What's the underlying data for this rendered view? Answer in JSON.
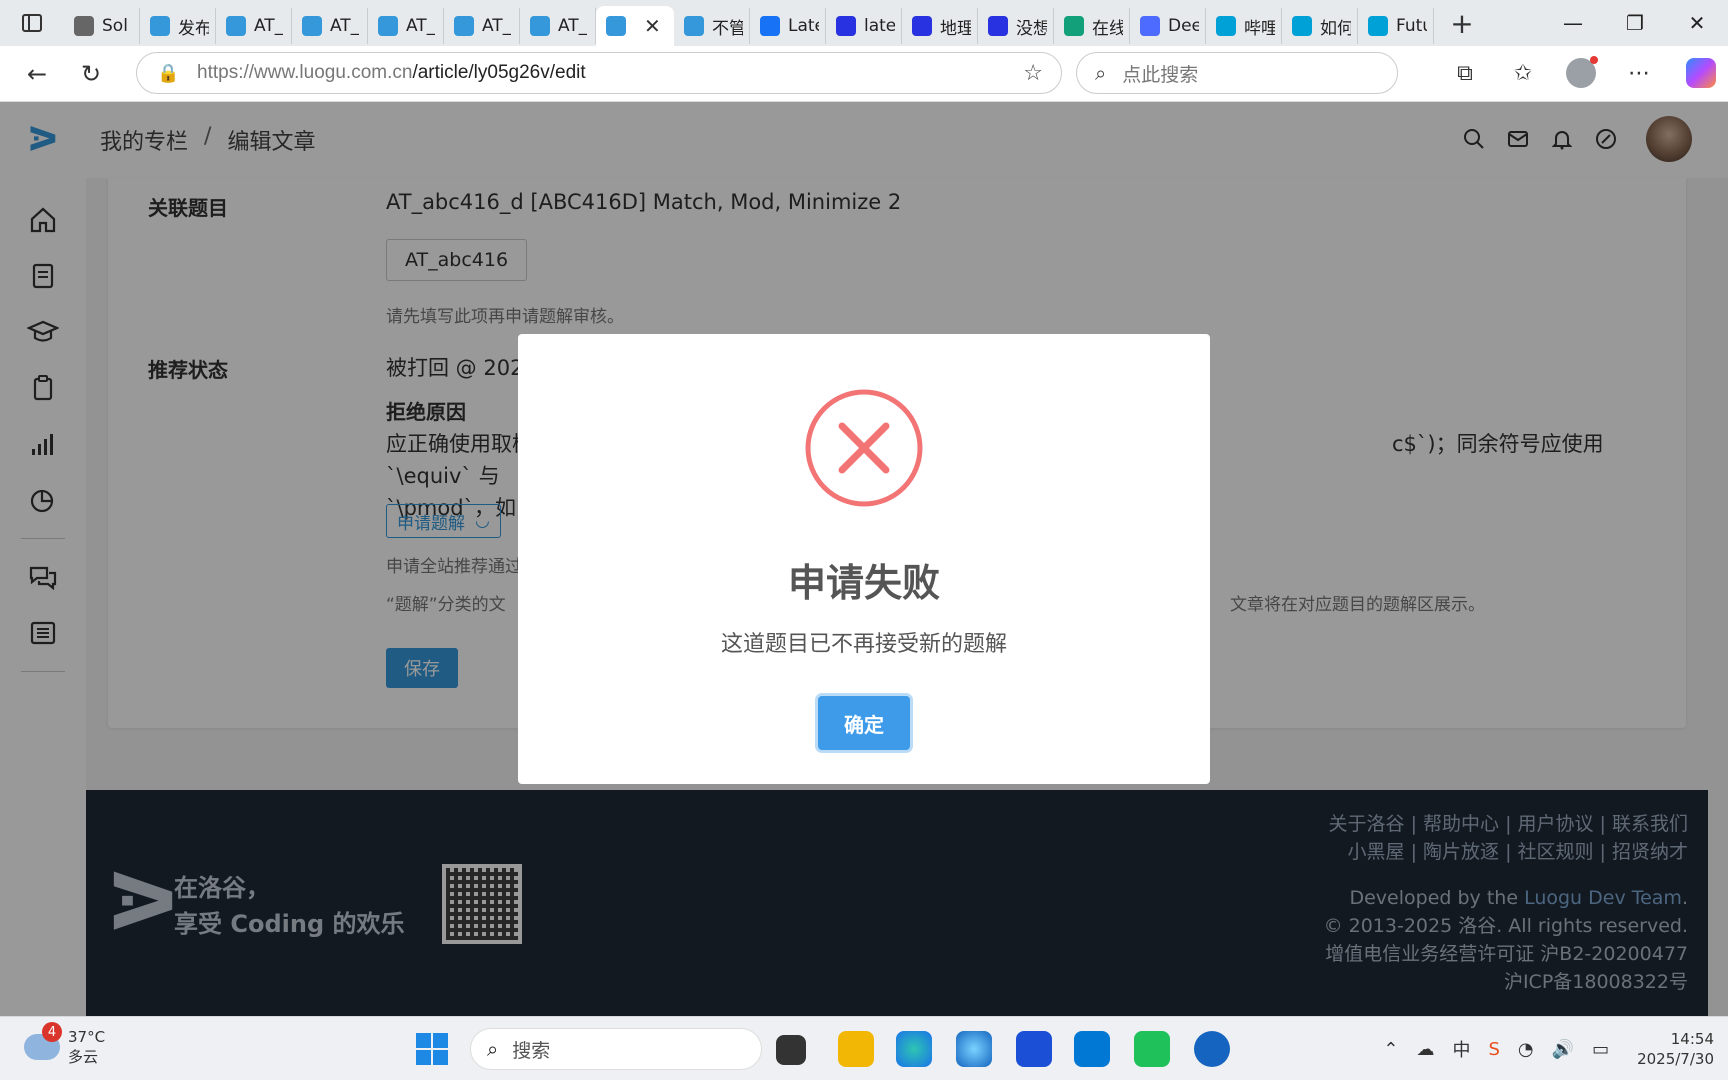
{
  "browser": {
    "tabs": [
      {
        "label": "Sol",
        "favicon": "globe-icon",
        "color": "#666666"
      },
      {
        "label": "发布",
        "favicon": "luogu-icon",
        "color": "#3498db"
      },
      {
        "label": "AT_",
        "favicon": "luogu-icon",
        "color": "#3498db"
      },
      {
        "label": "AT_",
        "favicon": "luogu-icon",
        "color": "#3498db"
      },
      {
        "label": "AT_",
        "favicon": "luogu-icon",
        "color": "#3498db"
      },
      {
        "label": "AT_",
        "favicon": "luogu-icon",
        "color": "#3498db"
      },
      {
        "label": "AT_",
        "favicon": "luogu-icon",
        "color": "#3498db"
      },
      {
        "label": "",
        "favicon": "luogu-icon",
        "color": "#3498db",
        "active": true
      },
      {
        "label": "不管",
        "favicon": "luogu-icon",
        "color": "#3498db"
      },
      {
        "label": "Late",
        "favicon": "zhihu-icon",
        "color": "#1772f6"
      },
      {
        "label": "late",
        "favicon": "baidu-icon",
        "color": "#2932e1"
      },
      {
        "label": "地理",
        "favicon": "baidu-icon",
        "color": "#2932e1"
      },
      {
        "label": "没想",
        "favicon": "baidu-icon",
        "color": "#2932e1"
      },
      {
        "label": "在线",
        "favicon": "xi-icon",
        "color": "#12a07a"
      },
      {
        "label": "Dee",
        "favicon": "deepseek-icon",
        "color": "#4d6bfe"
      },
      {
        "label": "哔哩",
        "favicon": "bilibili-icon",
        "color": "#00a1d6"
      },
      {
        "label": "如何",
        "favicon": "bilibili-icon",
        "color": "#00a1d6"
      },
      {
        "label": "Futu",
        "favicon": "bilibili-icon",
        "color": "#00a1d6"
      }
    ],
    "url_host": "https://www.luogu.com.cn",
    "url_path": "/article/ly05g26v/edit",
    "search_placeholder": "点此搜索"
  },
  "site": {
    "breadcrumb": [
      "我的专栏",
      "编辑文章"
    ],
    "breadcrumb_sep": "/"
  },
  "form": {
    "related_label": "关联题目",
    "related_value": "AT_abc416_d [ABC416D] Match, Mod, Minimize 2",
    "problem_tag": "AT_abc416",
    "related_hint": "请先填写此项再申请题解审核。",
    "recommend_label": "推荐状态",
    "recommend_value": "被打回 @ 2025-0",
    "reject_title": "拒绝原因",
    "reject_text_left": "应正确使用取模符",
    "reject_text_right": "c$`)；同余符号应使用 `\\equiv` 与",
    "reject_text_line2": "`\\pmod`，如 $",
    "apply_button": "申请题解",
    "apply_hint": "申请全站推荐通过后",
    "category_hint_left": "“题解”分类的文",
    "category_hint_right": "文章将在对应题目的题解区展示。",
    "save_button": "保存"
  },
  "footer": {
    "links_line1": "关于洛谷 | 帮助中心 | 用户协议 | 联系我们",
    "links_line2": "小黑屋 | 陶片放逐 | 社区规则 | 招贤纳才",
    "slogan_line1": "在洛谷，",
    "slogan_line2": "享受 Coding 的欢乐",
    "dev_prefix": "Developed by the ",
    "dev_team": "Luogu Dev Team",
    "dev_suffix": ".",
    "copyright": "© 2013-2025 洛谷. All rights reserved.",
    "license": "增值电信业务经营许可证 沪B2-20200477",
    "icp": "沪ICP备18008322号"
  },
  "modal": {
    "title": "申请失败",
    "message": "这道题目已不再接受新的题解",
    "ok_button": "确定",
    "icon": "error-circle-x-icon",
    "icon_color": "#f27474"
  },
  "taskbar": {
    "weather_temp": "37°C",
    "weather_desc": "多云",
    "weather_badge": "4",
    "search_label": "搜索",
    "ime_label": "中",
    "time": "14:54",
    "date": "2025/7/30"
  },
  "colors": {
    "accent": "#3498db",
    "footer_bg": "#1e2a38"
  }
}
